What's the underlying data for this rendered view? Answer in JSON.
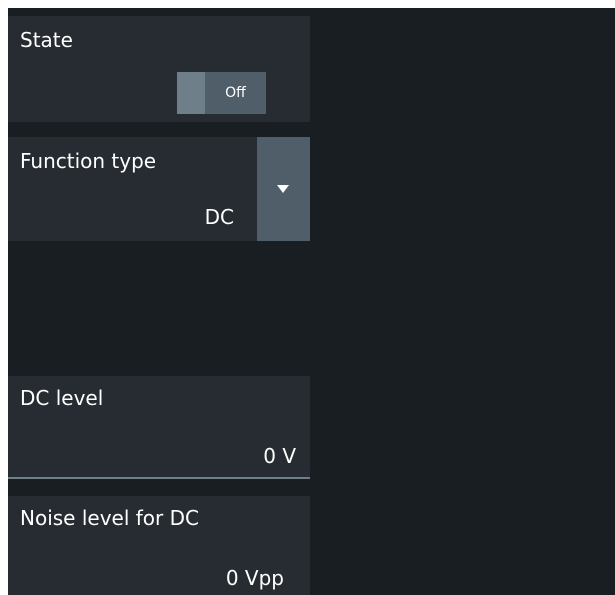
{
  "state": {
    "label": "State",
    "toggle_value": "Off"
  },
  "function_type": {
    "label": "Function type",
    "value": "DC",
    "dropdown_icon": "caret-down-icon"
  },
  "dc_level": {
    "label": "DC level",
    "value": "0 V"
  },
  "noise_level": {
    "label": "Noise level for DC",
    "value": "0 Vpp"
  },
  "colors": {
    "background": "#181e22",
    "panel": "#262c31",
    "control": "#4f5e68",
    "accent": "#6e7f8a",
    "text": "#ffffff"
  }
}
